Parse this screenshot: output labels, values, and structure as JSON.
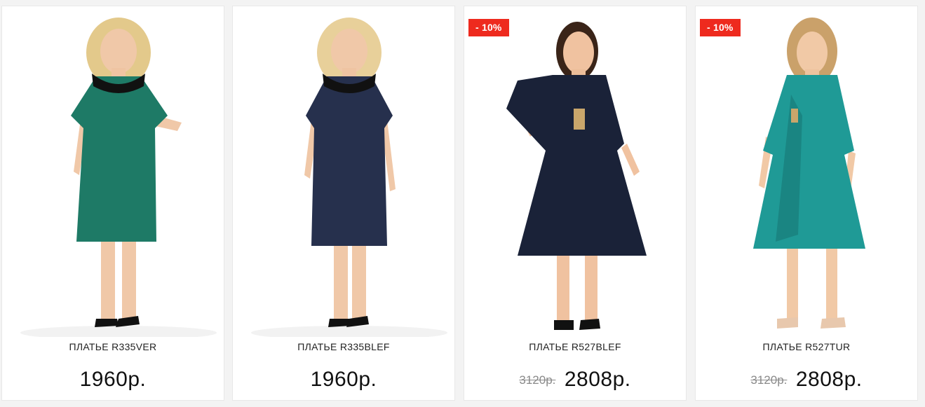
{
  "products": [
    {
      "name": "ПЛАТЬЕ R335VER",
      "badge": "",
      "old_price": "",
      "price": "1960р.",
      "dress_color": "#1e7a66",
      "collar_color": "#111111",
      "hair_color": "#e3c98b"
    },
    {
      "name": "ПЛАТЬЕ R335BLEF",
      "badge": "",
      "old_price": "",
      "price": "1960р.",
      "dress_color": "#26304d",
      "collar_color": "#111111",
      "hair_color": "#e8d09a"
    },
    {
      "name": "ПЛАТЬЕ R527BLEF",
      "badge": "- 10%",
      "old_price": "3120р.",
      "price": "2808р.",
      "dress_color": "#1a2238",
      "collar_color": "#1a2238",
      "hair_color": "#3a2418"
    },
    {
      "name": "ПЛАТЬЕ R527TUR",
      "badge": "- 10%",
      "old_price": "3120р.",
      "price": "2808р.",
      "dress_color": "#1f9a96",
      "collar_color": "#1f9a96",
      "hair_color": "#caa16a"
    }
  ],
  "colors": {
    "badge_bg": "#ee2a1e",
    "page_bg": "#f3f3f3",
    "card_bg": "#ffffff"
  }
}
